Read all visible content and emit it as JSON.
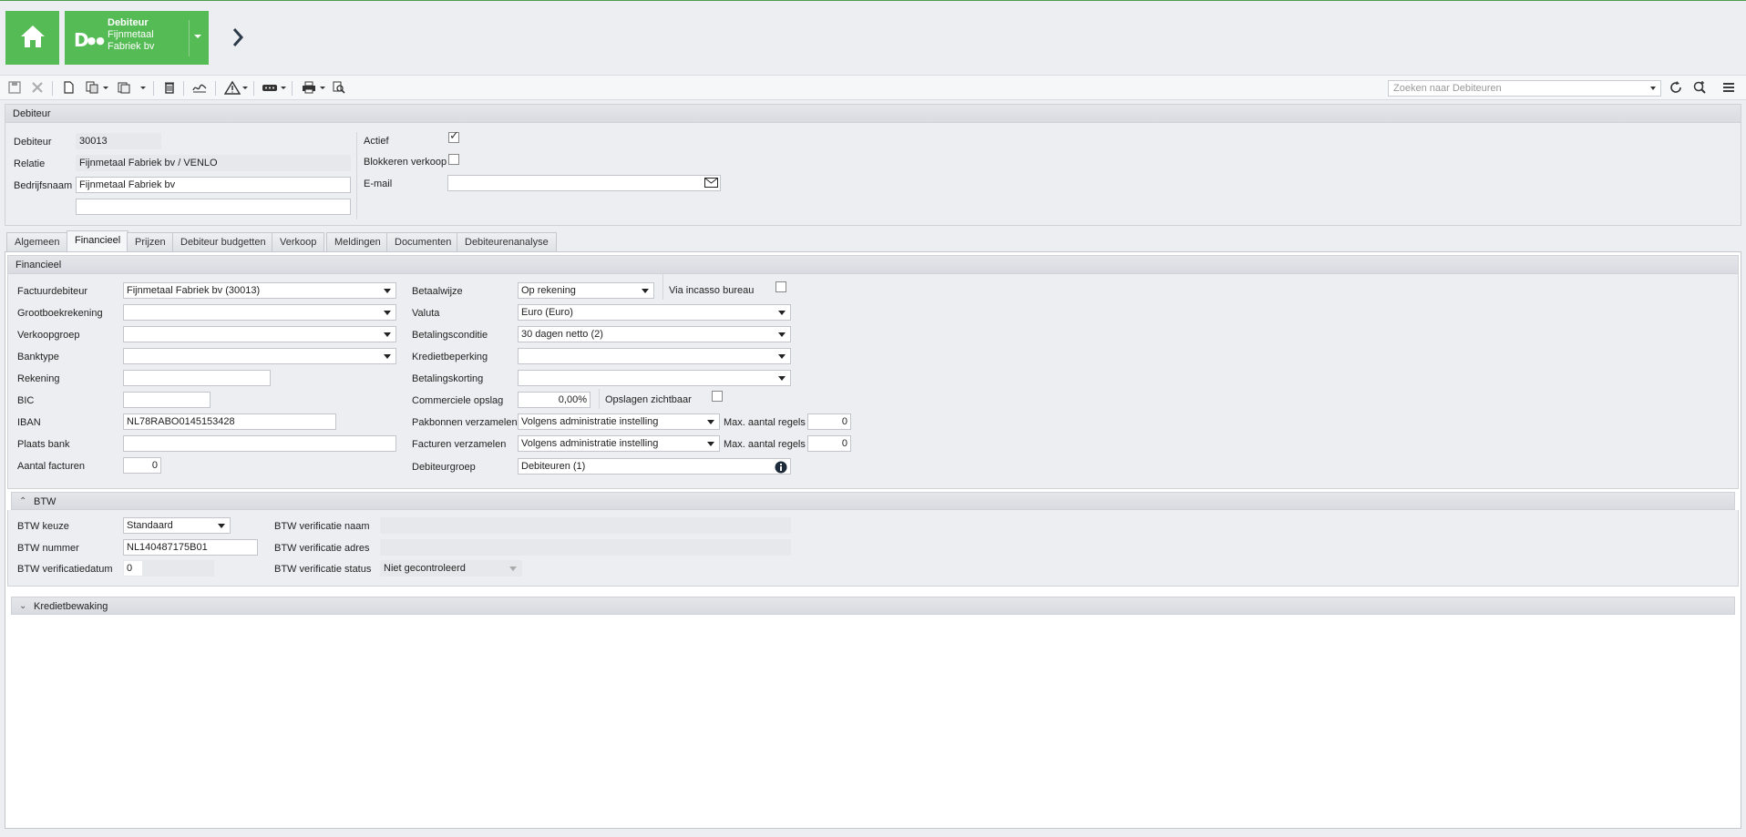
{
  "header": {
    "context_title": "Debiteur",
    "context_subtitle": "Fijnmetaal Fabriek bv",
    "context_logo": "D"
  },
  "toolbar": {
    "search_placeholder": "Zoeken naar Debiteuren"
  },
  "debiteur_panel": {
    "title": "Debiteur",
    "debiteur_label": "Debiteur",
    "debiteur_value": "30013",
    "relatie_label": "Relatie",
    "relatie_value": "Fijnmetaal Fabriek bv / VENLO",
    "bedrijfsnaam_label": "Bedrijfsnaam",
    "bedrijfsnaam_value": "Fijnmetaal Fabriek bv",
    "bedrijfsnaam2_value": "",
    "actief_label": "Actief",
    "actief_checked": true,
    "blokkeren_label": "Blokkeren verkoop",
    "blokkeren_checked": false,
    "email_label": "E-mail",
    "email_value": ""
  },
  "tabs": [
    {
      "label": "Algemeen"
    },
    {
      "label": "Financieel"
    },
    {
      "label": "Prijzen"
    },
    {
      "label": "Debiteur budgetten"
    },
    {
      "label": "Verkoop"
    },
    {
      "label": "Meldingen"
    },
    {
      "label": "Documenten"
    },
    {
      "label": "Debiteurenanalyse"
    }
  ],
  "active_tab": "Financieel",
  "financieel": {
    "title": "Financieel",
    "factuurdebiteur_label": "Factuurdebiteur",
    "factuurdebiteur_value": "Fijnmetaal Fabriek bv (30013)",
    "grootboek_label": "Grootboekrekening",
    "grootboek_value": "",
    "verkoopgroep_label": "Verkoopgroep",
    "verkoopgroep_value": "",
    "banktype_label": "Banktype",
    "banktype_value": "",
    "rekening_label": "Rekening",
    "rekening_value": "",
    "bic_label": "BIC",
    "bic_value": "",
    "iban_label": "IBAN",
    "iban_value": "NL78RABO0145153428",
    "plaatsbank_label": "Plaats bank",
    "plaatsbank_value": "",
    "aantal_facturen_label": "Aantal facturen",
    "aantal_facturen_value": "0",
    "betaalwijze_label": "Betaalwijze",
    "betaalwijze_value": "Op rekening",
    "incasso_label": "Via incasso bureau",
    "incasso_checked": false,
    "valuta_label": "Valuta",
    "valuta_value": "Euro (Euro)",
    "betalingsconditie_label": "Betalingsconditie",
    "betalingsconditie_value": "30 dagen netto (2)",
    "kredietbeperking_label": "Kredietbeperking",
    "kredietbeperking_value": "",
    "betalingskorting_label": "Betalingskorting",
    "betalingskorting_value": "",
    "commerciele_label": "Commerciele opslag",
    "commerciele_value": "0,00%",
    "opslagen_label": "Opslagen zichtbaar",
    "opslagen_checked": false,
    "pakbonnen_label": "Pakbonnen verzamelen",
    "pakbonnen_value": "Volgens administratie instelling",
    "max_regels_label": "Max. aantal regels",
    "pakbonnen_max_value": "0",
    "facturen_label": "Facturen verzamelen",
    "facturen_value": "Volgens administratie instelling",
    "facturen_max_value": "0",
    "debiteurgroep_label": "Debiteurgroep",
    "debiteurgroep_value": "Debiteuren (1)"
  },
  "btw": {
    "title": "BTW",
    "keuze_label": "BTW keuze",
    "keuze_value": "Standaard",
    "nummer_label": "BTW nummer",
    "nummer_value": "NL140487175B01",
    "verificatiedatum_label": "BTW verificatiedatum",
    "verificatiedatum_value": "0",
    "verif_naam_label": "BTW verificatie naam",
    "verif_naam_value": "",
    "verif_adres_label": "BTW verificatie adres",
    "verif_adres_value": "",
    "verif_status_label": "BTW verificatie status",
    "verif_status_value": "Niet gecontroleerd"
  },
  "kredietbewaking": {
    "title": "Kredietbewaking"
  }
}
